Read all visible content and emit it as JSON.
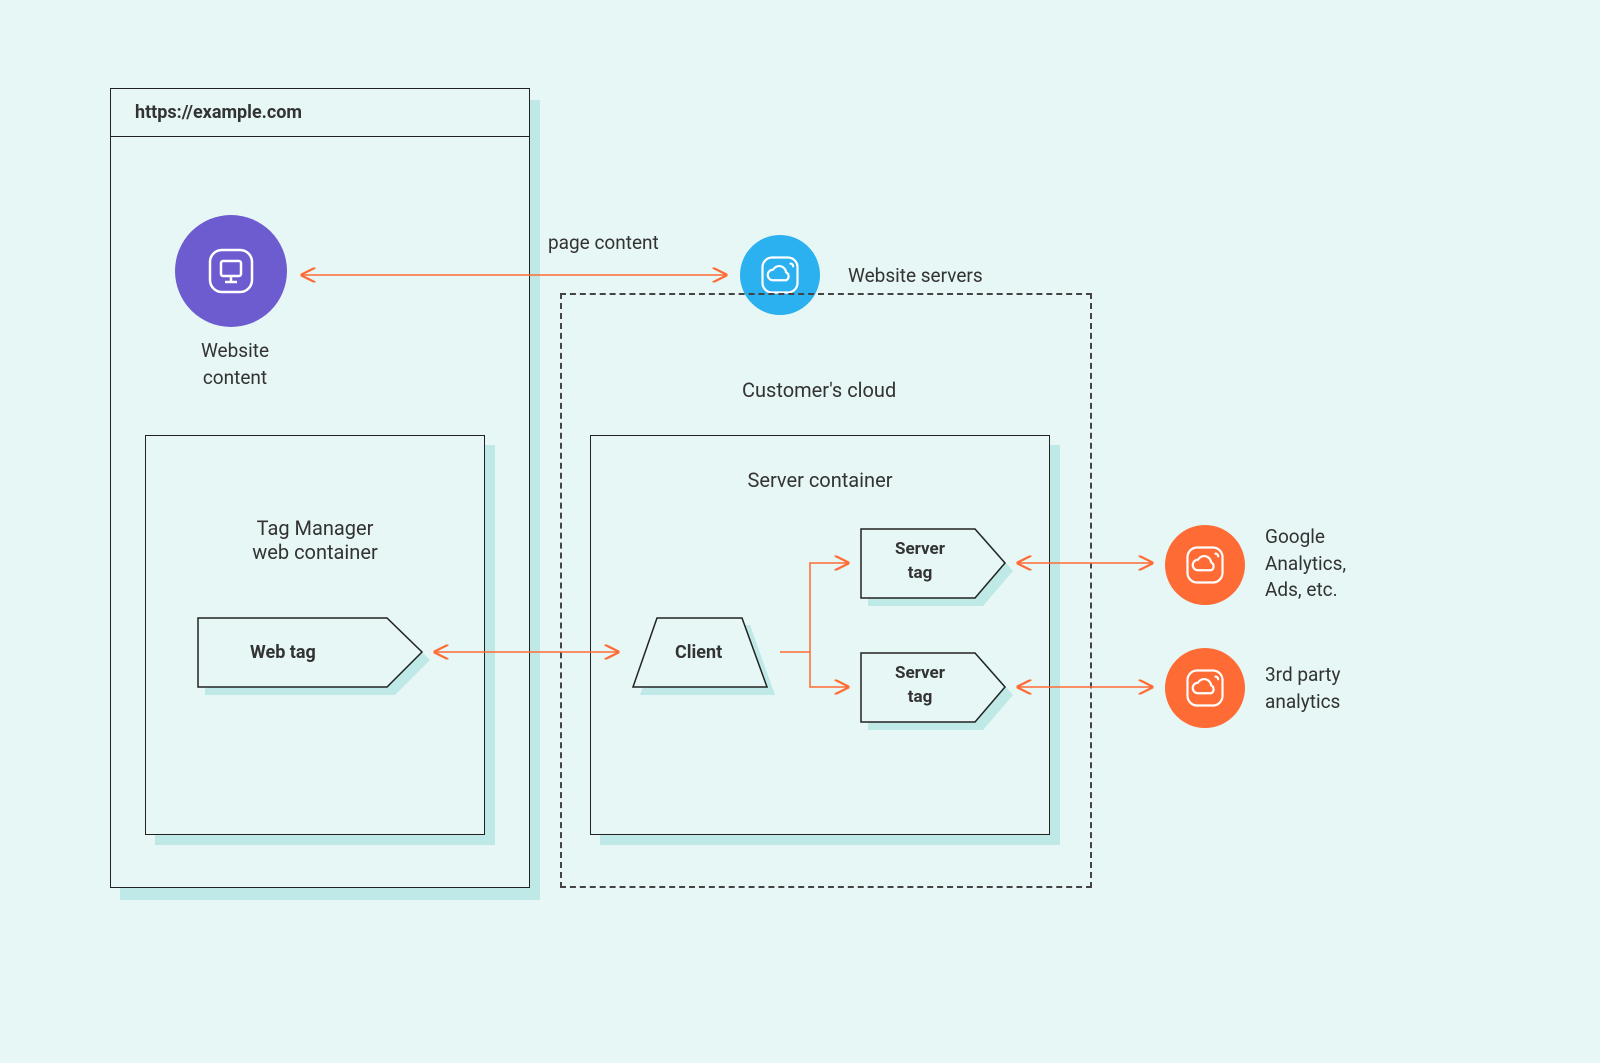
{
  "browser": {
    "url": "https://example.com",
    "website_content_label": "Website\ncontent",
    "tag_manager_label": "Tag Manager\nweb container",
    "web_tag_label": "Web tag"
  },
  "connections": {
    "page_content_label": "page content"
  },
  "servers": {
    "website_servers_label": "Website servers",
    "customers_cloud_label": "Customer's cloud",
    "server_container_label": "Server container",
    "client_label": "Client",
    "server_tag_1_label": "Server\ntag",
    "server_tag_2_label": "Server\ntag"
  },
  "external": {
    "google_label": "Google\nAnalytics,\nAds, etc.",
    "third_party_label": "3rd party\nanalytics"
  },
  "colors": {
    "bg": "#e6f7f5",
    "shadow": "#bfe9e6",
    "purple": "#6d5bd0",
    "blue": "#2bb0f0",
    "orange": "#ff6b35",
    "stroke": "#222"
  }
}
